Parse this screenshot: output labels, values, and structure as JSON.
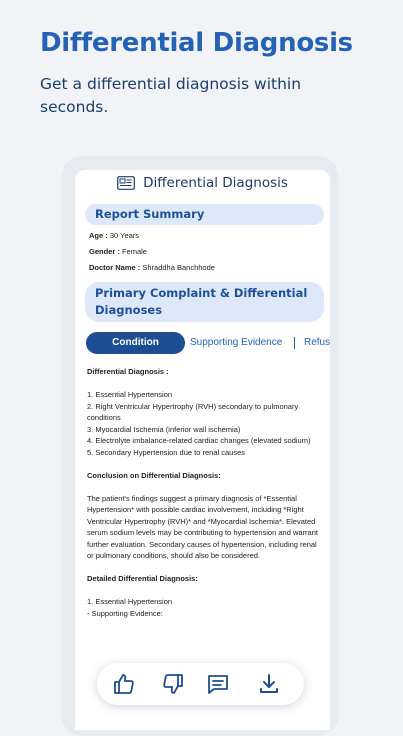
{
  "promo": {
    "title": "Differential Diagnosis",
    "subtitle": "Get a differential diagnosis within seconds."
  },
  "screen": {
    "title": "Differential Diagnosis",
    "header_icon": "report-icon",
    "report_summary": {
      "label": "Report Summary",
      "age_label": "Age :",
      "age_value": "30 Years",
      "gender_label": "Gender :",
      "gender_value": "Female",
      "doctor_label": "Doctor Name :",
      "doctor_value": "Shraddha Banchhode"
    },
    "complaint_label": "Primary Complaint & Differential Diagnoses",
    "tabs": [
      {
        "label": "Condition",
        "active": true
      },
      {
        "label": "Supporting Evidence",
        "active": false
      },
      {
        "label": "Refus",
        "active": false
      }
    ],
    "content": {
      "dd_heading": "Differential Diagnosis :",
      "dd_items": [
        "1. Essential Hypertension",
        "2. Right Ventricular Hypertrophy (RVH) secondary to pulmonary conditions",
        "3. Myocardial Ischemia (inferior wall ischemia)",
        "4. Electrolyte imbalance-related cardiac changes (elevated sodium)",
        "5. Secondary Hypertension due to renal causes"
      ],
      "conclusion_heading": "Conclusion on Differential Diagnosis:",
      "conclusion_text": "The patient's findings suggest a primary diagnosis of *Essential Hypertension* with possible cardiac involvement, including *Right Ventricular Hypertrophy (RVH)* and *Myocardial Ischemia*. Elevated serum sodium levels may be contributing to hypertension and warrant further evaluation. Secondary causes of hypertension, including renal or pulmonary conditions, should also be considered.",
      "detailed_heading": "Detailed Differential Diagnosis:",
      "detailed_items": [
        "1. Essential Hypertension",
        "- Supporting Evidence:"
      ]
    },
    "actions": [
      "thumbs-up-icon",
      "thumbs-down-icon",
      "comment-icon",
      "download-icon"
    ]
  },
  "colors": {
    "accent": "#2462b8",
    "dark_accent": "#1d4e93",
    "pill_bg": "#dde9fb",
    "page_bg": "#f1f3f6"
  }
}
